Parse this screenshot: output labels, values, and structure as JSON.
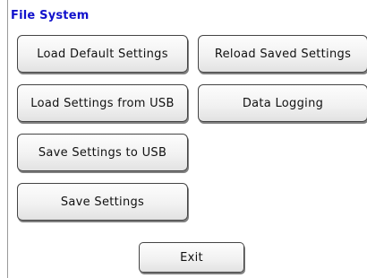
{
  "title": "File System",
  "buttons": {
    "load_default": "Load Default Settings",
    "reload_saved": "Reload Saved Settings",
    "load_usb": "Load Settings from USB",
    "data_logging": "Data Logging",
    "save_usb": "Save Settings to USB",
    "save_settings": "Save Settings",
    "exit": "Exit"
  },
  "colors": {
    "title": "#1111cc",
    "button_border": "#444444",
    "background": "#ffffff"
  }
}
